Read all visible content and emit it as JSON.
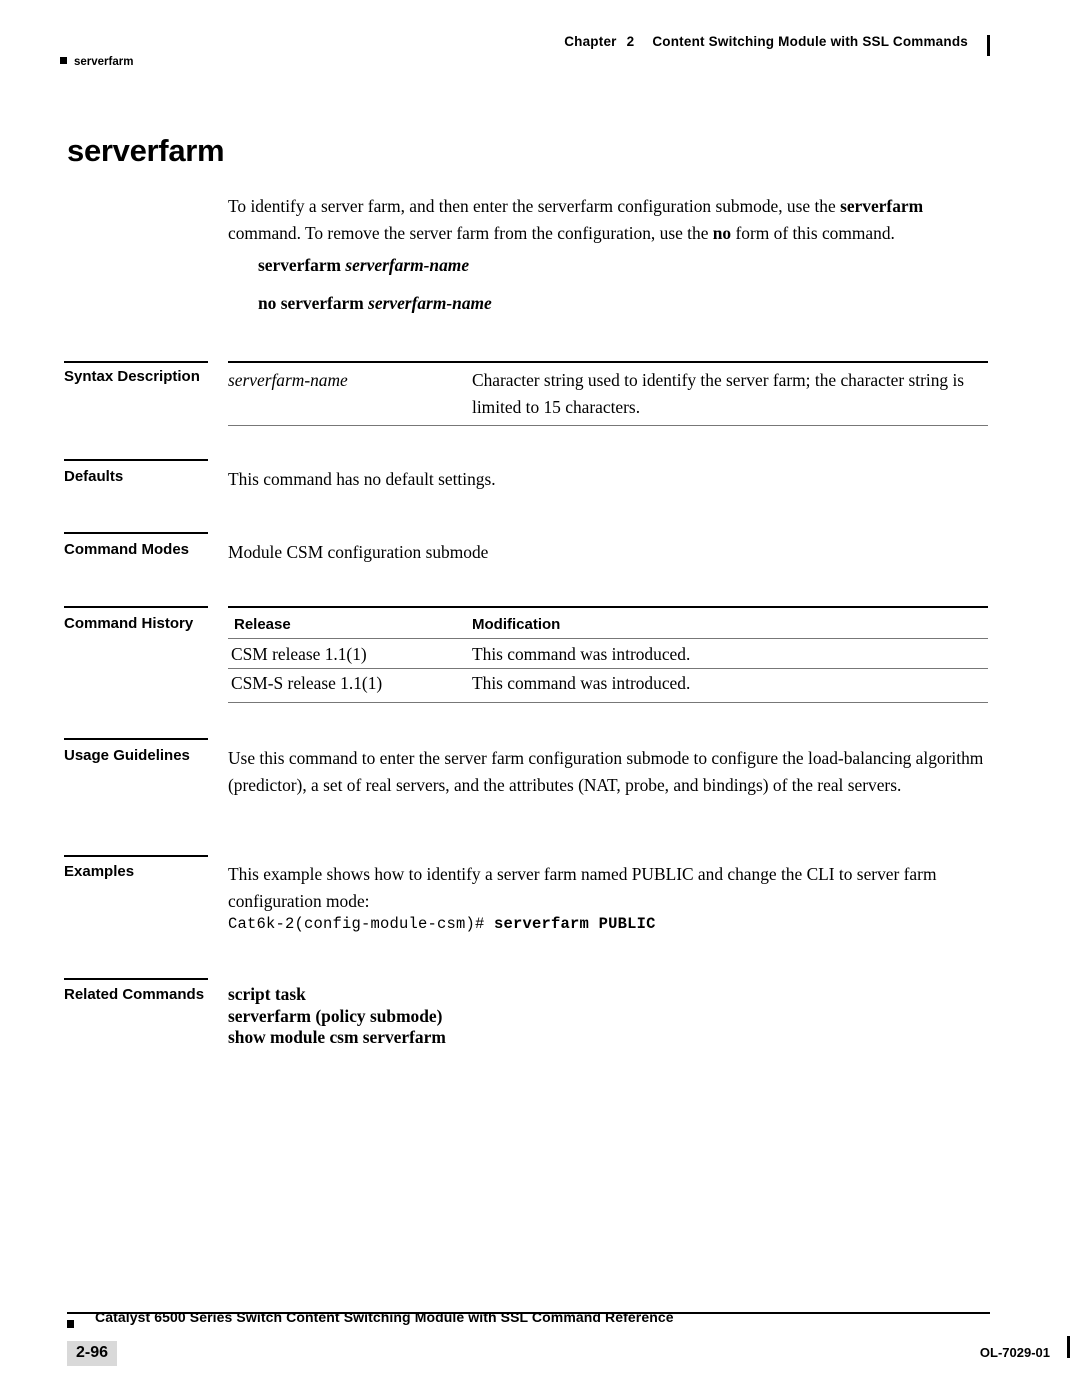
{
  "header": {
    "chapter_label": "Chapter",
    "chapter_number": "2",
    "chapter_title": "Content Switching Module with SSL Commands",
    "running_head": "serverfarm"
  },
  "title": "serverfarm",
  "intro": {
    "line1_a": "To identify a server farm, and then enter the serverfarm configuration submode, use the ",
    "line1_b": "serverfarm",
    "line2_a": "command. To remove the server farm from the configuration, use the ",
    "line2_b": "no",
    "line2_c": " form of this command."
  },
  "syntax": {
    "command": "serverfarm",
    "argument": "serverfarm-name",
    "no_prefix": "no serverfarm",
    "no_argument": "serverfarm-name"
  },
  "sections": {
    "syntax_description": {
      "label": "Syntax Description",
      "term": "serverfarm-name",
      "definition": "Character string used to identify the server farm; the character string is limited to 15 characters."
    },
    "defaults": {
      "label": "Defaults",
      "text": "This command has no default settings."
    },
    "command_modes": {
      "label": "Command Modes",
      "text": "Module CSM configuration submode"
    },
    "command_history": {
      "label": "Command History",
      "columns": [
        "Release",
        "Modification"
      ],
      "rows": [
        {
          "release": "CSM release 1.1(1)",
          "modification": "This command was introduced."
        },
        {
          "release": "CSM-S release 1.1(1)",
          "modification": "This command was introduced."
        }
      ]
    },
    "usage_guidelines": {
      "label": "Usage Guidelines",
      "text": "Use this command to enter the server farm configuration submode to configure the load-balancing algorithm (predictor), a set of real servers, and the attributes (NAT, probe, and bindings) of the real servers."
    },
    "examples": {
      "label": "Examples",
      "text": "This example shows how to identify a server farm named PUBLIC and change the CLI to server farm configuration mode:",
      "code_prompt": "Cat6k-2(config-module-csm)# ",
      "code_command": "serverfarm PUBLIC"
    },
    "related_commands": {
      "label": "Related Commands",
      "items": [
        "script task",
        "serverfarm (policy submode)",
        "show module csm serverfarm"
      ]
    }
  },
  "footer": {
    "document_title": "Catalyst 6500 Series Switch Content Switching Module with SSL Command Reference",
    "page_number": "2-96",
    "doc_id": "OL-7029-01"
  }
}
